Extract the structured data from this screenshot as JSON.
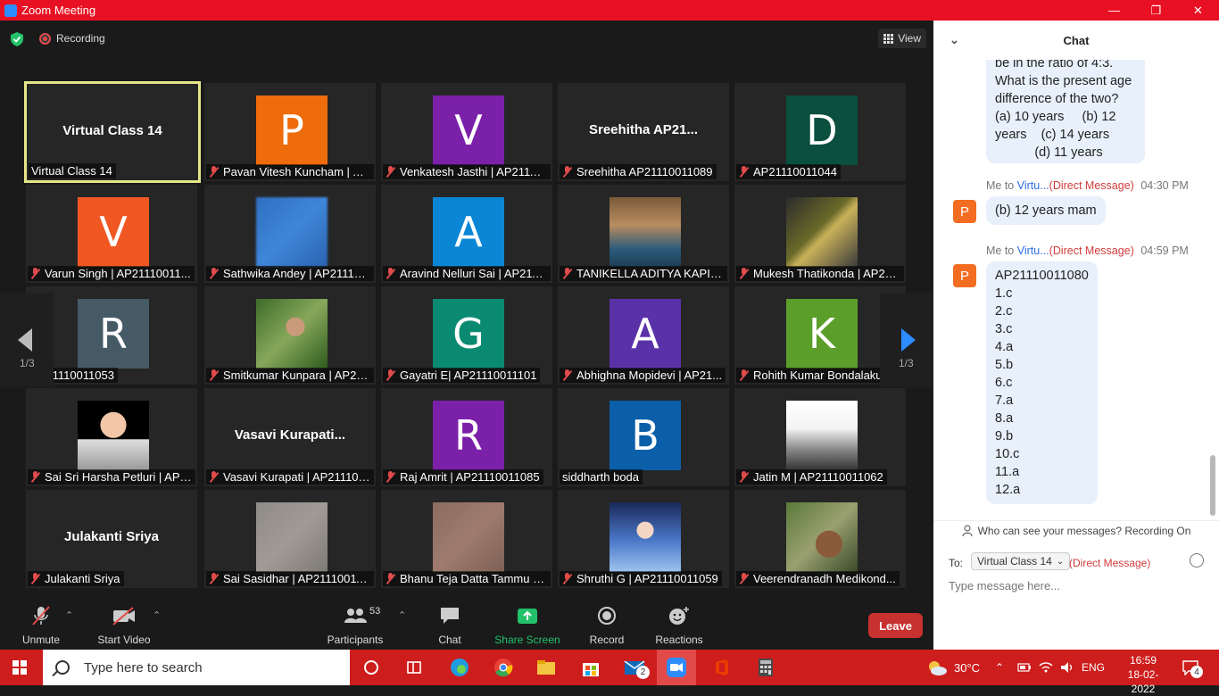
{
  "window": {
    "title": "Zoom Meeting",
    "min": "—",
    "max": "❐",
    "close": "✕"
  },
  "topbar": {
    "recording": "Recording",
    "view": "View"
  },
  "pagination": {
    "left": "1/3",
    "right": "1/3"
  },
  "tiles": [
    {
      "big": "Virtual Class 14",
      "name": "Virtual Class 14",
      "muted": false,
      "active": true
    },
    {
      "avatar": "P",
      "color": "#ee6c0c",
      "name": "Pavan Vitesh Kuncham | AP211...",
      "muted": true
    },
    {
      "avatar": "V",
      "color": "#7b20a8",
      "name": "Venkatesh Jasthi | AP21110...",
      "muted": true
    },
    {
      "big": "Sreehitha  AP21...",
      "name": "Sreehitha AP21110011089",
      "muted": true
    },
    {
      "avatar": "D",
      "color": "#0b4f3f",
      "name": "AP21110011044",
      "muted": true
    },
    {
      "avatar": "V",
      "color": "#f15722",
      "name": "Varun Singh | AP21110011...",
      "muted": true
    },
    {
      "photo": "blue-blur",
      "name": "Sathwika Andey | AP211100...",
      "muted": true
    },
    {
      "avatar": "A",
      "color": "#0b86d4",
      "name": "Aravind Nelluri Sai | AP211...",
      "muted": true
    },
    {
      "photo": "boy",
      "name": "TANIKELLA ADITYA KAPIL|A...",
      "muted": true
    },
    {
      "photo": "character",
      "name": "Mukesh Thatikonda | AP21...",
      "muted": true
    },
    {
      "avatar": "R",
      "color": "#465a66",
      "name": "AP21110011053",
      "muted": false
    },
    {
      "photo": "plant-boy",
      "name": "Smitkumar Kunpara | AP21...",
      "muted": true
    },
    {
      "avatar": "G",
      "color": "#0b8a72",
      "name": "Gayatri E| AP21110011101",
      "muted": true
    },
    {
      "avatar": "A",
      "color": "#5a32a8",
      "name": "Abhighna Mopidevi | AP21...",
      "muted": true
    },
    {
      "avatar": "K",
      "color": "#5b9e2a",
      "name": "Rohith Kumar Bondalakunt...",
      "muted": true
    },
    {
      "photo": "baby",
      "name": "Sai Sri Harsha Petluri | AP2...",
      "muted": true
    },
    {
      "big": "Vasavi  Kurapati...",
      "name": "Vasavi Kurapati | AP211100...",
      "muted": true
    },
    {
      "avatar": "R",
      "color": "#7b20a8",
      "name": "Raj Amrit | AP21110011085",
      "muted": true
    },
    {
      "avatar": "B",
      "color": "#0b5fa8",
      "name": "siddharth boda",
      "muted": false
    },
    {
      "photo": "flag",
      "name": "Jatin M | AP21110011062",
      "muted": true
    },
    {
      "big": "Julakanti Sriya",
      "name": "Julakanti Sriya",
      "muted": true
    },
    {
      "photo": "gray-blur",
      "name": "Sai Sasidhar | AP21110011...",
      "muted": true
    },
    {
      "photo": "brown-blur",
      "name": "Bhanu Teja Datta Tammu | ...",
      "muted": true
    },
    {
      "photo": "elsa",
      "name": "Shruthi G | AP21110011059",
      "muted": true
    },
    {
      "photo": "selfie",
      "name": "Veerendranadh Medikond...",
      "muted": true
    }
  ],
  "toolbar": {
    "unmute": "Unmute",
    "start_video": "Start Video",
    "participants": "Participants",
    "participant_count": "53",
    "chat": "Chat",
    "share_screen": "Share Screen",
    "record": "Record",
    "reactions": "Reactions",
    "leave": "Leave"
  },
  "chat": {
    "title": "Chat",
    "q_bubble": "be in the ratio of 4:3.\nWhat is the present age\ndifference of the two?\n(a) 10 years     (b) 12\nyears    (c) 14 years\n           (d) 11 years",
    "messages": [
      {
        "from": "Me to ",
        "to": "Virtu...",
        "dm": "(Direct Message)",
        "time": "04:30 PM",
        "avatar": "P",
        "text": "(b) 12 years mam"
      },
      {
        "from": "Me to ",
        "to": "Virtu...",
        "dm": "(Direct Message)",
        "time": "04:59 PM",
        "avatar": "P",
        "text": "AP21110011080\n1.c\n2.c\n3.c\n4.a\n5.b\n6.c\n7.a\n8.a\n9.b\n10.c\n11.a\n12.a"
      }
    ],
    "who_can_see": "Who can see your messages? Recording On",
    "to_label": "To:",
    "to_value": "Virtual Class 14",
    "dm_tag": "(Direct Message)",
    "placeholder": "Type message here..."
  },
  "taskbar": {
    "search": "Type here to search",
    "temp": "30°C",
    "lang": "ENG",
    "time": "16:59",
    "date": "18-02-2022",
    "mail_badge": "2",
    "notif_badge": "4"
  }
}
